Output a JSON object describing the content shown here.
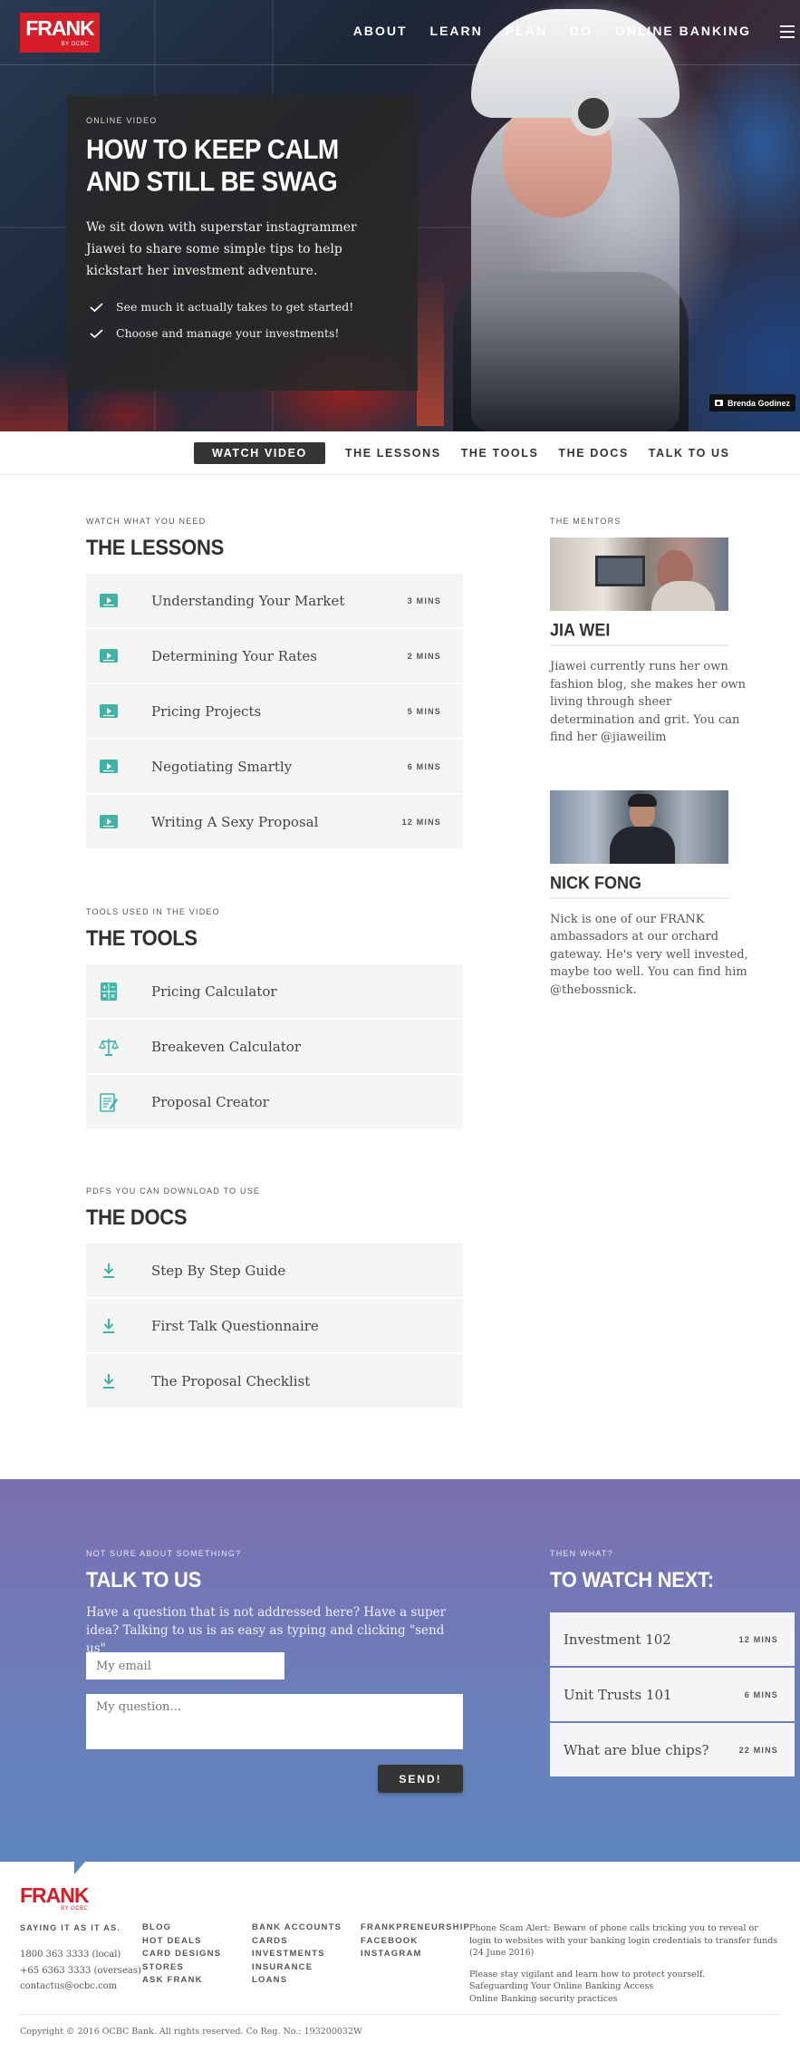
{
  "header": {
    "logo_word": "FRANK",
    "logo_by": "BY OCBC",
    "nav": [
      "ABOUT",
      "LEARN",
      "PLAN",
      "DO",
      "ONLINE BANKING"
    ],
    "menu_icon": "hamburger-icon"
  },
  "hero": {
    "eyebrow": "ONLINE VIDEO",
    "title_line1": "HOW TO KEEP CALM",
    "title_line2": "AND STILL BE SWAG",
    "description": "We sit down with superstar instagrammer Jiawei to share some simple tips to help kickstart her investment adventure.",
    "checks": [
      "See much it actually takes to get started!",
      "Choose and manage your investments!"
    ],
    "photo_credit": "Brenda Godinez"
  },
  "subnav": {
    "items": [
      "WATCH VIDEO",
      "THE LESSONS",
      "THE TOOLS",
      "THE DOCS",
      "TALK TO US"
    ],
    "active_index": 0
  },
  "lessons": {
    "eyebrow": "WATCH WHAT YOU NEED",
    "title": "THE LESSONS",
    "items": [
      {
        "label": "Understanding Your Market",
        "mins": "3 MINS"
      },
      {
        "label": "Determining Your Rates",
        "mins": "2 MINS"
      },
      {
        "label": "Pricing Projects",
        "mins": "5 MINS"
      },
      {
        "label": "Negotiating Smartly",
        "mins": "6 MINS"
      },
      {
        "label": "Writing A Sexy Proposal",
        "mins": "12 MINS"
      }
    ]
  },
  "tools": {
    "eyebrow": "TOOLS USED IN THE VIDEO",
    "title": "THE TOOLS",
    "items": [
      {
        "label": "Pricing Calculator",
        "icon": "calculator-icon"
      },
      {
        "label": "Breakeven Calculator",
        "icon": "scale-icon"
      },
      {
        "label": "Proposal Creator",
        "icon": "document-edit-icon"
      }
    ]
  },
  "docs": {
    "eyebrow": "PDFS YOU CAN DOWNLOAD TO USE",
    "title": "THE DOCS",
    "items": [
      {
        "label": "Step By Step Guide"
      },
      {
        "label": "First Talk Questionnaire"
      },
      {
        "label": "The Proposal Checklist"
      }
    ]
  },
  "mentors": {
    "eyebrow": "THE MENTORS",
    "items": [
      {
        "name": "JIA WEI",
        "bio": "Jiawei currently runs her own fashion blog, she makes her own living through sheer determination and grit. You can find her @jiaweilim"
      },
      {
        "name": "NICK FONG",
        "bio": "Nick is one of our FRANK ambassadors at our orchard gateway. He's very well invested, maybe too well. You can find him @thebossnick."
      }
    ]
  },
  "talk": {
    "eyebrow": "NOT SURE ABOUT SOMETHING?",
    "title": "TALK TO US",
    "description": "Have a question that is not addressed here? Have a super idea? Talking to us is as easy as typing and clicking \"send us\"",
    "email_placeholder": "My email",
    "question_placeholder": "My question...",
    "send_label": "SEND!"
  },
  "watch_next": {
    "eyebrow": "THEN WHAT?",
    "title": "TO WATCH NEXT:",
    "items": [
      {
        "label": "Investment 102",
        "mins": "12 MINS"
      },
      {
        "label": "Unit Trusts 101",
        "mins": "6 MINS"
      },
      {
        "label": "What are blue chips?",
        "mins": "22 MINS"
      }
    ]
  },
  "footer": {
    "tagline": "SAYING IT AS IT AS.",
    "contact": [
      "1800 363 3333 (local)",
      "+65 6363 3333 (overseas)",
      "contactus@ocbc.com"
    ],
    "col1": [
      "BLOG",
      "HOT DEALS",
      "CARD DESIGNS",
      "STORES",
      "ASK FRANK"
    ],
    "col2": [
      "BANK ACCOUNTS",
      "CARDS",
      "INVESTMENTS",
      "INSURANCE",
      "LOANS"
    ],
    "col3": [
      "FRANKPRENEURSHIP",
      "FACEBOOK",
      "INSTAGRAM"
    ],
    "alert": "Phone Scam Alert: Beware of phone calls tricking you to reveal or login to websites with your banking login credentials to transfer funds (24 June 2016)",
    "vigilant": [
      "Please stay vigilant and learn how to protect yourself.",
      "Safeguarding Your Online Banking Access",
      "Online Banking security practices"
    ],
    "copyright": "Copyright © 2016 OCBC Bank. All rights reserved. Co Reg. No.: 193200032W"
  },
  "colors": {
    "brand_red": "#d71e28",
    "teal_icon": "#3fb3a6",
    "dark_button": "#353535",
    "purple_start": "#7b6fb0",
    "blue_end": "#5f86c0"
  }
}
